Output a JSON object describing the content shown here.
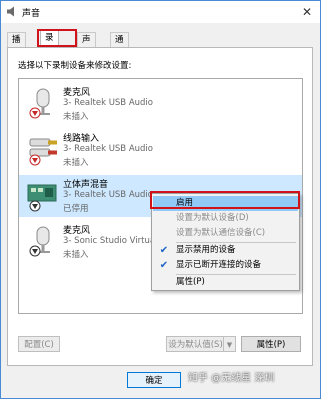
{
  "window": {
    "title": "声音",
    "close_glyph": "✕"
  },
  "tabs": [
    {
      "label": "播放"
    },
    {
      "label": "录制",
      "active": true
    },
    {
      "label": "声音"
    },
    {
      "label": "通信"
    }
  ],
  "instruction": "选择以下录制设备来修改设置:",
  "devices": [
    {
      "name": "麦克风",
      "driver": "3- Realtek USB Audio",
      "status": "未插入",
      "icon": "microphone-icon"
    },
    {
      "name": "线路输入",
      "driver": "3- Realtek USB Audio",
      "status": "未插入",
      "icon": "line-in-icon"
    },
    {
      "name": "立体声混音",
      "driver": "3- Realtek USB Audio",
      "status": "已停用",
      "icon": "stereo-mix-icon",
      "selected": true
    },
    {
      "name": "麦克风",
      "driver": "3- Sonic Studio Virtual",
      "status": "未插入",
      "icon": "microphone-icon"
    }
  ],
  "context_menu": {
    "items": [
      {
        "label": "启用",
        "state": "hover"
      },
      {
        "label": "设置为默认设备(D)",
        "state": "disabled"
      },
      {
        "label": "设置为默认通信设备(C)",
        "state": "disabled"
      },
      {
        "label": "显示禁用的设备",
        "checked": true
      },
      {
        "label": "显示已断开连接的设备",
        "checked": true
      },
      {
        "label": "属性(P)"
      }
    ],
    "check_glyph": "✔"
  },
  "buttons": {
    "configure": "配置(C)",
    "set_default": "设为默认值(S)",
    "properties": "属性(P)",
    "ok": "确定"
  },
  "watermark": "知乎 @无线星 深圳",
  "colors": {
    "selection": "#cde8ff",
    "menu_hover": "#91c9f7",
    "highlight_box": "#d0131a",
    "check": "#1c63c6"
  }
}
